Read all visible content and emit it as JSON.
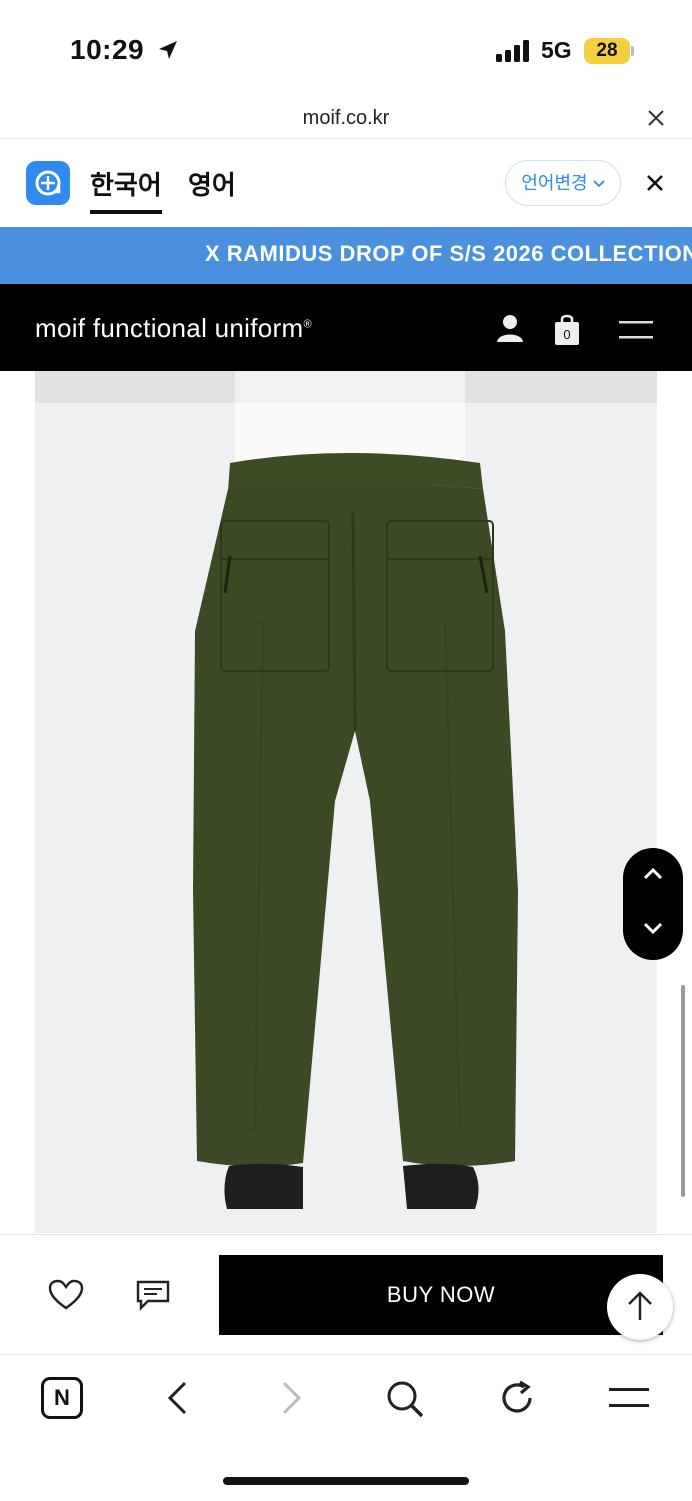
{
  "status_bar": {
    "time": "10:29",
    "network": "5G",
    "battery": "28"
  },
  "browser": {
    "url": "moif.co.kr"
  },
  "translate_bar": {
    "lang_source": "한국어",
    "lang_target": "영어",
    "change_label": "언어변경"
  },
  "banner": {
    "text": "X RAMIDUS DROP OF S/S 2026 COLLECTION"
  },
  "header": {
    "brand": "moif functional uniform",
    "brand_mark": "®",
    "cart_count": "0"
  },
  "product": {
    "image": "olive-green-nylon-wide-pants-back-view"
  },
  "actions": {
    "buy_now": "BUY NOW"
  },
  "browser_nav": {
    "home_label": "N"
  },
  "colors": {
    "banner": "#4a90de",
    "header": "#000000",
    "pants": "#3b4a24",
    "accent": "#2f8bf0"
  }
}
